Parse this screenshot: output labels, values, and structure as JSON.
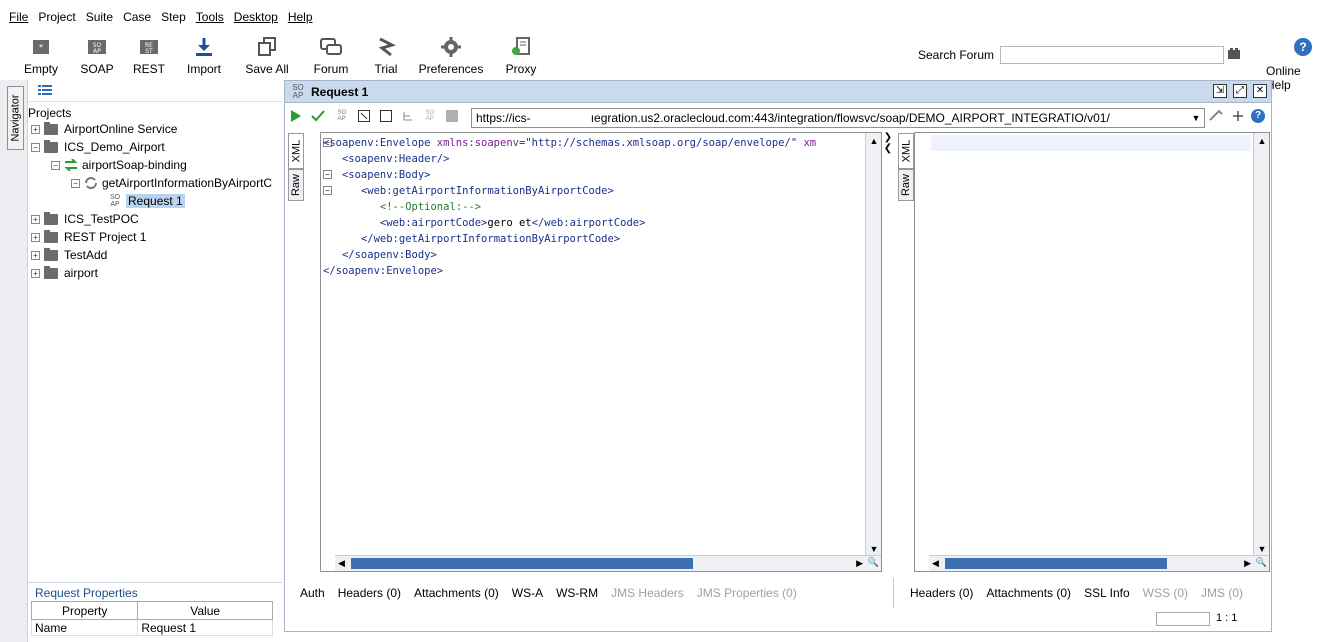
{
  "menu": [
    "File",
    "Project",
    "Suite",
    "Case",
    "Step",
    "Tools",
    "Desktop",
    "Help"
  ],
  "toolbar": {
    "buttons": [
      "Empty",
      "SOAP",
      "REST",
      "Import",
      "Save All",
      "Forum",
      "Trial",
      "Preferences",
      "Proxy"
    ],
    "search_label": "Search Forum",
    "search_value": "",
    "online_help": "Online Help"
  },
  "navigator": {
    "tab_label": "Navigator",
    "projects_label": "Projects",
    "tree": {
      "airport_online": "AirportOnline Service",
      "ics_demo": "ICS_Demo_Airport",
      "binding": "airportSoap-binding",
      "operation": "getAirportInformationByAirportC",
      "request": "Request 1",
      "ics_testpoc": "ICS_TestPOC",
      "rest_project": "REST Project 1",
      "testadd": "TestAdd",
      "airport": "airport"
    }
  },
  "request_properties": {
    "title": "Request Properties",
    "headers": [
      "Property",
      "Value"
    ],
    "rows": [
      {
        "property": "Name",
        "value": "Request 1"
      }
    ]
  },
  "request_window": {
    "icon_text": "SO AP",
    "title": "Request 1",
    "url_part1": "https://ics-",
    "url_part2": "ıegration.us2.oraclecloud.com:443/integration/flowsvc/soap/DEMO_AIRPORT_INTEGRATIO/v01/",
    "left_side_tabs": [
      "XML",
      "Raw"
    ],
    "right_side_tabs": [
      "XML",
      "Raw"
    ],
    "xml_lines": [
      {
        "indent": 0,
        "parts": [
          [
            "tag",
            "<soapenv:Envelope"
          ],
          [
            "attr",
            " xmlns:soapenv"
          ],
          [
            "tag",
            "="
          ],
          [
            "str",
            "\"http://schemas.xmlsoap.org/soap/envelope/\""
          ],
          [
            "attr",
            " xm"
          ]
        ]
      },
      {
        "indent": 1,
        "parts": [
          [
            "tag",
            "<soapenv:Header/>"
          ]
        ]
      },
      {
        "indent": 1,
        "parts": [
          [
            "tag",
            "<soapenv:Body>"
          ]
        ]
      },
      {
        "indent": 2,
        "parts": [
          [
            "tag",
            "<web:getAirportInformationByAirportCode>"
          ]
        ]
      },
      {
        "indent": 3,
        "parts": [
          [
            "cmt",
            "<!--Optional:-->"
          ]
        ]
      },
      {
        "indent": 3,
        "parts": [
          [
            "tag",
            "<web:airportCode>"
          ],
          [
            "txt",
            "gero et"
          ],
          [
            "tag",
            "</web:airportCode>"
          ]
        ]
      },
      {
        "indent": 2,
        "parts": [
          [
            "tag",
            "</web:getAirportInformationByAirportCode>"
          ]
        ]
      },
      {
        "indent": 1,
        "parts": [
          [
            "tag",
            "</soapenv:Body>"
          ]
        ]
      },
      {
        "indent": 0,
        "parts": [
          [
            "tag",
            "</soapenv:Envelope>"
          ]
        ]
      }
    ],
    "request_tabs": [
      {
        "label": "Auth",
        "enabled": true
      },
      {
        "label": "Headers (0)",
        "enabled": true
      },
      {
        "label": "Attachments (0)",
        "enabled": true
      },
      {
        "label": "WS-A",
        "enabled": true
      },
      {
        "label": "WS-RM",
        "enabled": true
      },
      {
        "label": "JMS Headers",
        "enabled": false
      },
      {
        "label": "JMS Properties (0)",
        "enabled": false
      }
    ],
    "response_tabs": [
      {
        "label": "Headers (0)",
        "enabled": true
      },
      {
        "label": "Attachments (0)",
        "enabled": true
      },
      {
        "label": "SSL Info",
        "enabled": true
      },
      {
        "label": "WSS (0)",
        "enabled": false
      },
      {
        "label": "JMS (0)",
        "enabled": false
      }
    ],
    "status_position": "1 : 1"
  }
}
